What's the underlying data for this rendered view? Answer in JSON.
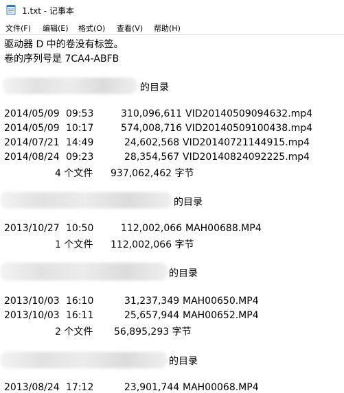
{
  "window": {
    "title": "1.txt - 记事本"
  },
  "menu": [
    "文件(F)",
    "编辑(E)",
    "格式(O)",
    "查看(V)",
    "帮助(H)"
  ],
  "content": {
    "header1": "驱动器 D 中的卷没有标签。",
    "header2": "卷的序列号是 7CA4-ABFB",
    "dir_suffix": "的目录",
    "section1": {
      "files": [
        {
          "date": "2014/05/09",
          "time": "09:53",
          "size": "310,096,611",
          "name": "VID20140509094632.mp4"
        },
        {
          "date": "2014/05/09",
          "time": "10:17",
          "size": "574,008,716",
          "name": "VID20140509100438.mp4"
        },
        {
          "date": "2014/07/21",
          "time": "14:49",
          "size": "24,602,568",
          "name": "VID20140721144915.mp4"
        },
        {
          "date": "2014/08/24",
          "time": "09:23",
          "size": "28,354,567",
          "name": "VID20140824092225.mp4"
        }
      ],
      "summary_count": "4 个文件",
      "summary_bytes": "937,062,462 字节"
    },
    "section2": {
      "files": [
        {
          "date": "2013/10/27",
          "time": "10:50",
          "size": "112,002,066",
          "name": "MAH00688.MP4"
        }
      ],
      "summary_count": "1 个文件",
      "summary_bytes": "112,002,066 字节"
    },
    "section3": {
      "files": [
        {
          "date": "2013/10/03",
          "time": "16:10",
          "size": "31,237,349",
          "name": "MAH00650.MP4"
        },
        {
          "date": "2013/10/03",
          "time": "16:11",
          "size": "25,657,944",
          "name": "MAH00652.MP4"
        }
      ],
      "summary_count": "2 个文件",
      "summary_bytes": "56,895,293 字节"
    },
    "section4": {
      "files": [
        {
          "date": "2013/08/24",
          "time": "17:12",
          "size": "23,901,744",
          "name": "MAH00068.MP4"
        }
      ]
    }
  }
}
